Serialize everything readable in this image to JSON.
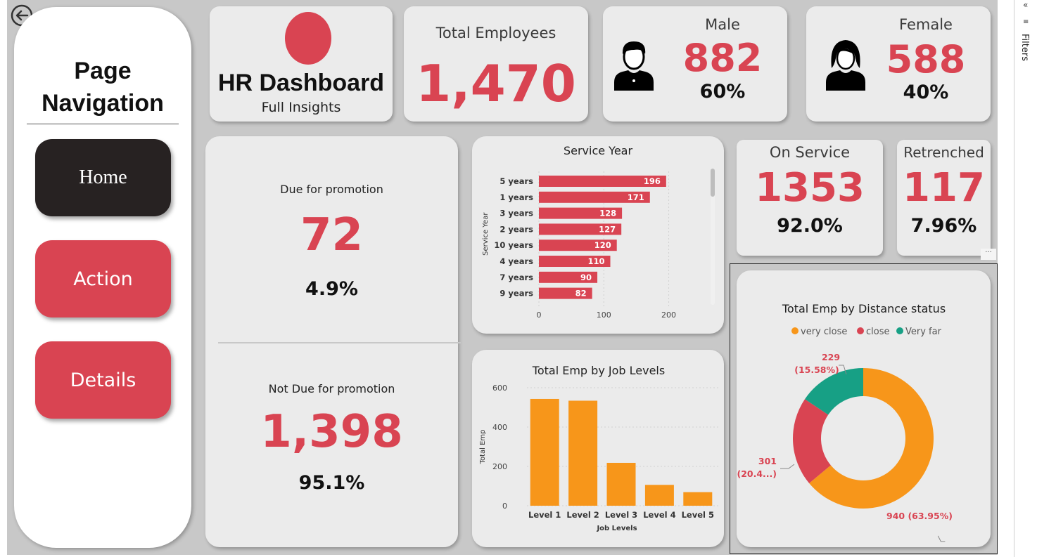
{
  "nav": {
    "title_line1": "Page",
    "title_line2": "Navigation",
    "buttons": [
      {
        "label": "Home",
        "color": "#272222"
      },
      {
        "label": "Action",
        "color": "#d94452"
      },
      {
        "label": "Details",
        "color": "#d94452"
      }
    ]
  },
  "brand": {
    "title": "HR Dashboard",
    "subtitle": "Full Insights",
    "logo_color": "#d94452"
  },
  "kpis": {
    "total_employees": {
      "label": "Total Employees",
      "value": "1,470"
    },
    "male": {
      "label": "Male",
      "value": "882",
      "pct": "60%",
      "icon": "male-user-icon"
    },
    "female": {
      "label": "Female",
      "value": "588",
      "pct": "40%",
      "icon": "female-user-icon"
    },
    "on_service": {
      "label": "On Service",
      "value": "1353",
      "pct": "92.0%"
    },
    "retrenched": {
      "label": "Retrenched",
      "value": "117",
      "pct": "7.96%"
    }
  },
  "promotion": {
    "due_label": "Due for promotion",
    "due_value": "72",
    "due_pct": "4.9%",
    "not_due_label": "Not Due for promotion",
    "not_due_value": "1,398",
    "not_due_pct": "95.1%"
  },
  "sidebar": {
    "filters_label": "Filters",
    "more_label": "···"
  },
  "colors": {
    "accent": "#d94452",
    "orange": "#f7961a",
    "teal": "#17a085",
    "dark": "#272222"
  },
  "chart_data": [
    {
      "type": "bar",
      "orientation": "horizontal",
      "title": "Service Year",
      "ylabel": "Service Year",
      "xlabel": "",
      "categories": [
        "5 years",
        "1 years",
        "3 years",
        "2 years",
        "10 years",
        "4 years",
        "7 years",
        "9 years"
      ],
      "values": [
        196,
        171,
        128,
        127,
        120,
        110,
        90,
        82
      ],
      "xlim": [
        0,
        220
      ],
      "xticks": [
        0,
        100,
        200
      ],
      "color": "#d94452"
    },
    {
      "type": "bar",
      "title": "Total Emp by Job Levels",
      "xlabel": "Job Levels",
      "ylabel": "Total Emp",
      "categories": [
        "Level 1",
        "Level 2",
        "Level 3",
        "Level 4",
        "Level 5"
      ],
      "values": [
        543,
        534,
        218,
        106,
        69
      ],
      "ylim": [
        0,
        600
      ],
      "yticks": [
        0,
        200,
        400,
        600
      ],
      "color": "#f7961a"
    },
    {
      "type": "pie",
      "donut": true,
      "title": "Total Emp by Distance status",
      "legend_position": "top",
      "series": [
        {
          "name": "very close",
          "value": 940,
          "label": "940 (63.95%)",
          "color": "#f7961a"
        },
        {
          "name": "close",
          "value": 301,
          "label_line1": "301",
          "label_line2": "(20.4...)",
          "color": "#d94452"
        },
        {
          "name": "Very far",
          "value": 229,
          "label_line1": "229",
          "label_line2": "(15.58%)",
          "color": "#17a085"
        }
      ]
    }
  ]
}
